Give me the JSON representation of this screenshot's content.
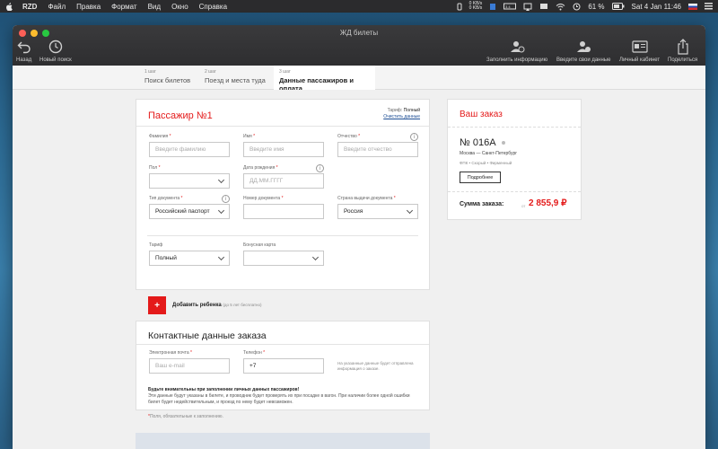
{
  "menubar": {
    "app_name": "RZD",
    "items": [
      "Файл",
      "Правка",
      "Формат",
      "Вид",
      "Окно",
      "Справка"
    ],
    "net_up": "0 KB/s",
    "net_down": "0 KB/s",
    "battery": "61 %",
    "datetime": "Sat 4 Jan  11:46"
  },
  "window": {
    "title": "ЖД билеты"
  },
  "toolbar": {
    "back": "Назад",
    "new_search": "Новый поиск",
    "fill_info": "Заполнить информацию",
    "enter_data": "Введите свои данные",
    "account": "Личный кабинет",
    "share": "Поделиться"
  },
  "steps": [
    {
      "num": "1 шаг",
      "label": "Поиск билетов"
    },
    {
      "num": "2 шаг",
      "label": "Поезд и места туда"
    },
    {
      "num": "3 шаг",
      "label": "Данные пассажиров и оплата"
    }
  ],
  "passenger": {
    "title": "Пассажир №1",
    "tariff_label": "Тариф:",
    "tariff_value": "Полный",
    "clear": "Очистить данные",
    "surname_label": "Фамилия",
    "surname_placeholder": "Введите фамилию",
    "name_label": "Имя",
    "name_placeholder": "Введите имя",
    "patronymic_label": "Отчество",
    "patronymic_placeholder": "Введите отчество",
    "sex_label": "Пол",
    "sex_value": "",
    "birth_label": "Дата рождения",
    "birth_placeholder": "ДД.ММ.ГГГГ",
    "doc_type_label": "Тип документа",
    "doc_type_value": "Российский паспорт",
    "doc_num_label": "Номер документа",
    "country_label": "Страна выдачи документа",
    "country_value": "Россия",
    "tariff_field_label": "Тариф",
    "tariff_field_value": "Полный",
    "bonus_label": "Бонусная карта",
    "bonus_value": "",
    "required_mark": "*"
  },
  "add_child": {
    "plus": "+",
    "label": "Добавить ребенка",
    "hint": "(до 5 лет бесплатно)"
  },
  "contact": {
    "title": "Контактные данные заказа",
    "email_label": "Электронная почта",
    "email_placeholder": "Ваш e-mail",
    "phone_label": "Телефон",
    "phone_value": "+7",
    "note": "На указанные данные будет отправлена информация о заказе."
  },
  "warning": {
    "title": "Будьте внимательны при заполнении личных данных пассажиров!",
    "text": "Эти данные будут указаны в билете, и проводник будет проверять их при посадке в вагон. При наличии более одной ошибки билет будет недействительным, и проезд по нему будет невозможен.",
    "required_note": "Поля, обязательные к заполнению."
  },
  "order": {
    "title": "Ваш заказ",
    "train_no": "№ 016А",
    "route": "Москва — Санкт-Петербург",
    "meta": "ФПК • Скорый • Фирменный",
    "more": "Подробнее",
    "sum_label": "Сумма заказа:",
    "sum_from": "от",
    "sum_value": "2 855,9 ₽"
  },
  "colors": {
    "accent": "#e41a1a",
    "link": "#1d4e94"
  }
}
